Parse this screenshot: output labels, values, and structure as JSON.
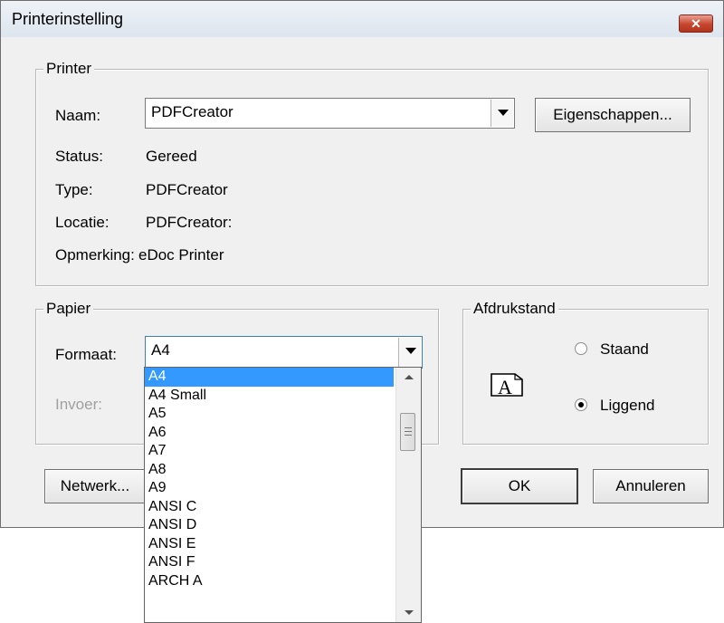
{
  "window": {
    "title": "Printerinstelling",
    "close_glyph": "✕"
  },
  "printer": {
    "group_label": "Printer",
    "name_label": "Naam:",
    "name_value": "PDFCreator",
    "properties_button": "Eigenschappen...",
    "status_label": "Status:",
    "status_value": "Gereed",
    "type_label": "Type:",
    "type_value": "PDFCreator",
    "location_label": "Locatie:",
    "location_value": "PDFCreator:",
    "comment_label": "Opmerking:",
    "comment_value": "eDoc Printer"
  },
  "paper": {
    "group_label": "Papier",
    "format_label": "Formaat:",
    "format_value": "A4",
    "source_label": "Invoer:"
  },
  "orientation": {
    "group_label": "Afdrukstand",
    "portrait_label": "Staand",
    "landscape_label": "Liggend",
    "selected": "Liggend",
    "icon": "landscape-page-icon",
    "icon_letter": "A"
  },
  "buttons": {
    "network": "Netwerk...",
    "ok": "OK",
    "cancel": "Annuleren"
  },
  "format_options": [
    "A4",
    "A4 Small",
    "A5",
    "A6",
    "A7",
    "A8",
    "A9",
    "ANSI C",
    "ANSI D",
    "ANSI E",
    "ANSI F",
    "ARCH A"
  ],
  "colors": {
    "selection": "#3399ff",
    "dialog_bg": "#f0f0f0",
    "close_button": "#c7452d"
  }
}
